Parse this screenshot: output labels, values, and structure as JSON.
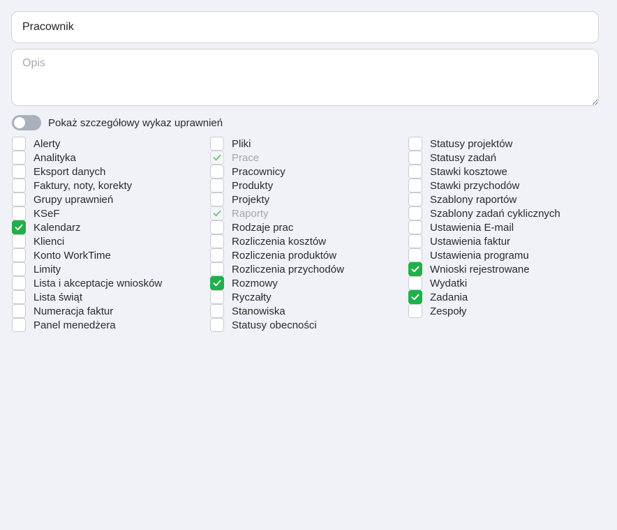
{
  "form": {
    "name_value": "Pracownik",
    "description_placeholder": "Opis",
    "toggle_label": "Pokaż szczegółowy wykaz uprawnień",
    "toggle_on": false
  },
  "permissions": {
    "columns": [
      [
        {
          "label": "Alerty",
          "state": "unchecked"
        },
        {
          "label": "Analityka",
          "state": "unchecked"
        },
        {
          "label": "Eksport danych",
          "state": "unchecked"
        },
        {
          "label": "Faktury, noty, korekty",
          "state": "unchecked"
        },
        {
          "label": "Grupy uprawnień",
          "state": "unchecked"
        },
        {
          "label": "KSeF",
          "state": "unchecked"
        },
        {
          "label": "Kalendarz",
          "state": "checked"
        },
        {
          "label": "Klienci",
          "state": "unchecked"
        },
        {
          "label": "Konto WorkTime",
          "state": "unchecked"
        },
        {
          "label": "Limity",
          "state": "unchecked"
        },
        {
          "label": "Lista i akceptacje wniosków",
          "state": "unchecked"
        },
        {
          "label": "Lista świąt",
          "state": "unchecked"
        },
        {
          "label": "Numeracja faktur",
          "state": "unchecked"
        },
        {
          "label": "Panel menedżera",
          "state": "unchecked"
        }
      ],
      [
        {
          "label": "Pliki",
          "state": "unchecked"
        },
        {
          "label": "Prace",
          "state": "disabled-checked"
        },
        {
          "label": "Pracownicy",
          "state": "unchecked"
        },
        {
          "label": "Produkty",
          "state": "unchecked"
        },
        {
          "label": "Projekty",
          "state": "unchecked"
        },
        {
          "label": "Raporty",
          "state": "disabled-checked"
        },
        {
          "label": "Rodzaje prac",
          "state": "unchecked"
        },
        {
          "label": "Rozliczenia kosztów",
          "state": "unchecked"
        },
        {
          "label": "Rozliczenia produktów",
          "state": "unchecked"
        },
        {
          "label": "Rozliczenia przychodów",
          "state": "unchecked"
        },
        {
          "label": "Rozmowy",
          "state": "checked"
        },
        {
          "label": "Ryczałty",
          "state": "unchecked"
        },
        {
          "label": "Stanowiska",
          "state": "unchecked"
        },
        {
          "label": "Statusy obecności",
          "state": "unchecked"
        }
      ],
      [
        {
          "label": "Statusy projektów",
          "state": "unchecked"
        },
        {
          "label": "Statusy zadań",
          "state": "unchecked"
        },
        {
          "label": "Stawki kosztowe",
          "state": "unchecked"
        },
        {
          "label": "Stawki przychodów",
          "state": "unchecked"
        },
        {
          "label": "Szablony raportów",
          "state": "unchecked"
        },
        {
          "label": "Szablony zadań cyklicznych",
          "state": "unchecked"
        },
        {
          "label": "Ustawienia E-mail",
          "state": "unchecked"
        },
        {
          "label": "Ustawienia faktur",
          "state": "unchecked"
        },
        {
          "label": "Ustawienia programu",
          "state": "unchecked"
        },
        {
          "label": "Wnioski rejestrowane",
          "state": "checked"
        },
        {
          "label": "Wydatki",
          "state": "unchecked"
        },
        {
          "label": "Zadania",
          "state": "checked"
        },
        {
          "label": "Zespoły",
          "state": "unchecked"
        }
      ]
    ]
  },
  "colors": {
    "background": "#f1f2f7",
    "checked": "#20b04b",
    "disabled_check": "#74c48d",
    "toggle_off": "#aab0bc"
  },
  "icons": {
    "check": "checkmark-icon"
  }
}
